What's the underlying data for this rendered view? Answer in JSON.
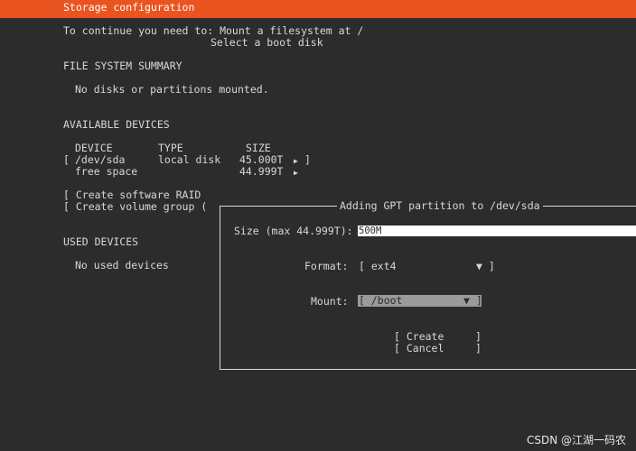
{
  "header": {
    "title": "Storage configuration"
  },
  "instructions": {
    "line1": "To continue you need to: Mount a filesystem at /",
    "line2": "Select a boot disk"
  },
  "summary": {
    "heading": "FILE SYSTEM SUMMARY",
    "empty": "No disks or partitions mounted."
  },
  "available": {
    "heading": "AVAILABLE DEVICES",
    "columns": {
      "device": "DEVICE",
      "type": "TYPE",
      "size": "SIZE"
    },
    "rows": [
      {
        "open": "[",
        "device": "/dev/sda",
        "type": "local disk",
        "size": "45.000T",
        "arrow": "▶",
        "close": "]"
      },
      {
        "device": "free space",
        "size": "44.999T",
        "arrow": "▶"
      }
    ],
    "actions": {
      "raid": "[ Create software RAID",
      "volume_group": "[ Create volume group ("
    }
  },
  "used": {
    "heading": "USED DEVICES",
    "empty": "No used devices"
  },
  "dialog": {
    "title": "Adding GPT partition to /dev/sda",
    "size_label": "Size (max 44.999T):",
    "size_value": "500M",
    "format_label": "Format:",
    "format_value": "[ ext4",
    "format_arrow": "▼ ]",
    "mount_label": "Mount:",
    "mount_value": "[ /boot",
    "mount_arrow": "▼ ]",
    "create": "[ Create     ]",
    "cancel": "[ Cancel     ]"
  },
  "watermark": "CSDN @江湖一码农"
}
